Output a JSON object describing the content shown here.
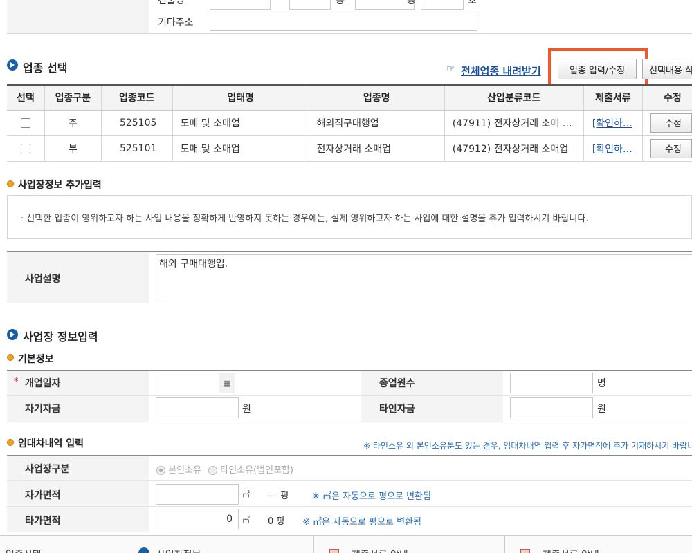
{
  "address": {
    "partial_top_label": "건물명",
    "extra_address_label": "기타주소",
    "extra_address_value": "",
    "unit_dong": "동",
    "unit_ho": "호"
  },
  "industry": {
    "title": "업종 선택",
    "download_link": "전체업종 내려받기",
    "input_button": "업종 입력/수정",
    "select_button": "선택내용 삭제",
    "columns": [
      "선택",
      "업종구분",
      "업종코드",
      "업태명",
      "업종명",
      "산업분류코드",
      "제출서류",
      "수정"
    ],
    "rows": [
      {
        "type": "주",
        "code": "525105",
        "business": "도매 및 소매업",
        "name": "해외직구대행업",
        "class_code": "(47911) 전자상거래 소매 …",
        "docs": "[확인하…",
        "edit": "수정"
      },
      {
        "type": "부",
        "code": "525101",
        "business": "도매 및 소매업",
        "name": "전자상거래 소매업",
        "class_code": "(47912) 전자상거래 소매업",
        "docs": "[확인하…",
        "edit": "수정"
      }
    ]
  },
  "extra_info": {
    "title": "사업장정보 추가입력",
    "notice": "선택한 업종이 영위하고자 하는 사업 내용을 정확하게 반영하지 못하는 경우에는, 실제 영위하고자 하는 사업에 대한 설명을 추가 입력하시기 바랍니다.",
    "desc_label": "사업설명",
    "desc_value": "해외 구매대행업."
  },
  "business_info": {
    "title": "사업장 정보입력",
    "basic_title": "기본정보",
    "open_date_label": "개업일자",
    "open_date_value": "",
    "employees_label": "종업원수",
    "employees_value": "",
    "employees_unit": "명",
    "own_capital_label": "자기자금",
    "own_capital_value": "",
    "won": "원",
    "other_capital_label": "타인자금",
    "other_capital_value": ""
  },
  "lease": {
    "title": "임대차내역 입력",
    "notice": "※ 타인소유 외 본인소유분도 있는 경우, 임대차내역 입력 후 자가면적에 추가 기재하시기 바랍니다",
    "type_label": "사업장구분",
    "option_own": "본인소유",
    "option_other": "타인소유(법인포함)",
    "own_area_label": "자가면적",
    "own_area_value": "",
    "sqm": "㎡",
    "own_pyeong": "--- 평",
    "auto_note": "※ ㎡은 자동으로 평으로 변환됨",
    "other_area_label": "타가면적",
    "other_area_value": "0",
    "other_pyeong": "0 평"
  },
  "footer": {
    "items": [
      "업종선택",
      "사업자정보",
      "제출서류 안내",
      "제출서류 안내"
    ]
  }
}
